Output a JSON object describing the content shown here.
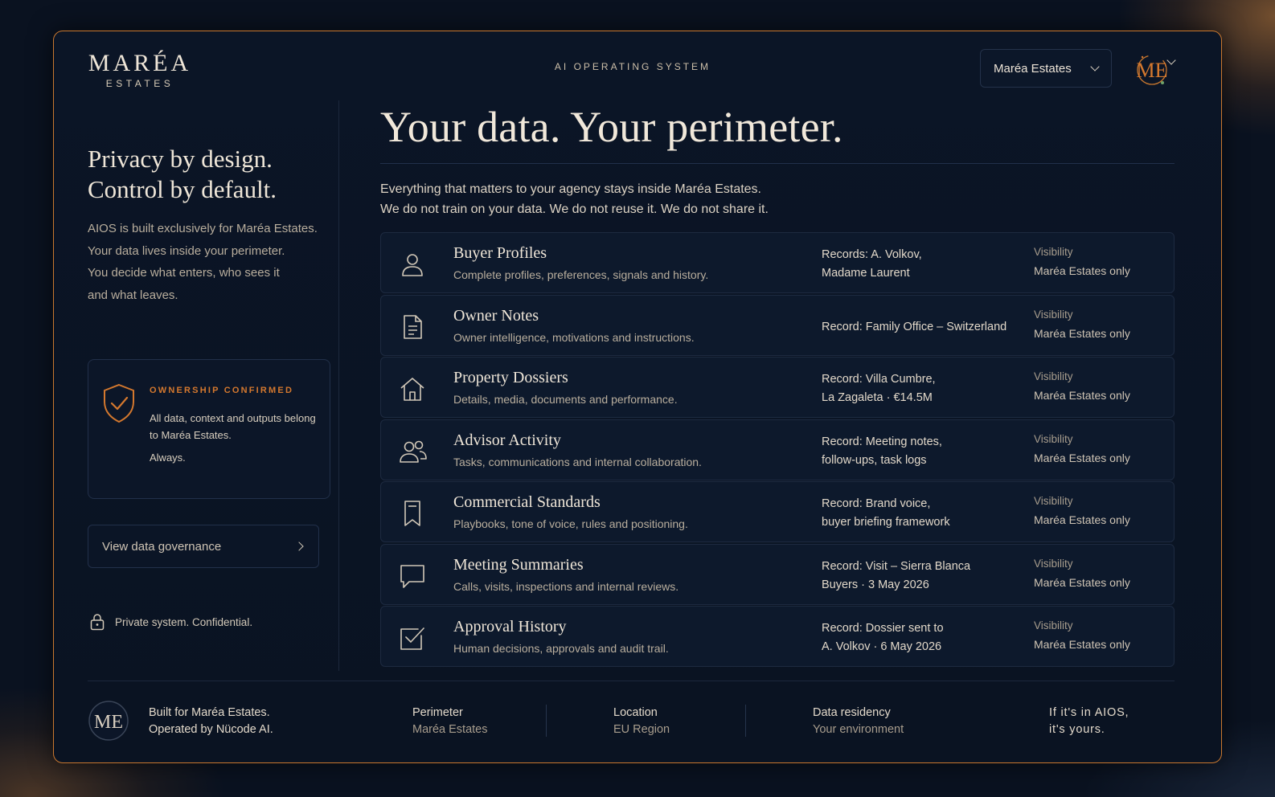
{
  "brand": {
    "name": "MARÉA",
    "sub": "ESTATES"
  },
  "header": {
    "os_label": "AI OPERATING SYSTEM",
    "account": "Maréa Estates",
    "avatar_initials": "ME"
  },
  "left": {
    "title_line1": "Privacy by design.",
    "title_line2": "Control by default.",
    "desc_lines": [
      "AIOS is built exclusively for Maréa Estates.",
      "Your data lives inside your perimeter.",
      "You decide what enters, who sees it",
      "and what leaves."
    ],
    "ownership": {
      "title": "OWNERSHIP CONFIRMED",
      "text": "All data, context and outputs belong to Maréa Estates.",
      "always": "Always."
    },
    "governance_button": "View data governance",
    "private_note": "Private system. Confidential."
  },
  "main": {
    "title": "Your data. Your perimeter.",
    "desc_line1": "Everything that matters to your agency stays inside Maréa Estates.",
    "desc_line2": "We do not train on your data. We do not reuse it. We do not share it.",
    "rows": [
      {
        "icon": "user-icon",
        "name": "Buyer Profiles",
        "desc": "Complete profiles, preferences, signals and history.",
        "record_line1": "Records: A. Volkov,",
        "record_line2": "Madame Laurent",
        "vis_label": "Visibility",
        "vis_value": "Maréa Estates only"
      },
      {
        "icon": "document-icon",
        "name": "Owner Notes",
        "desc": "Owner intelligence, motivations and instructions.",
        "record_line1": "Record: Family Office – Switzerland",
        "record_line2": "",
        "vis_label": "Visibility",
        "vis_value": "Maréa Estates only"
      },
      {
        "icon": "house-icon",
        "name": "Property Dossiers",
        "desc": "Details, media, documents and performance.",
        "record_line1": "Record: Villa Cumbre,",
        "record_line2": "La Zagaleta · €14.5M",
        "vis_label": "Visibility",
        "vis_value": "Maréa Estates only"
      },
      {
        "icon": "users-icon",
        "name": "Advisor Activity",
        "desc": "Tasks, communications and internal collaboration.",
        "record_line1": "Record: Meeting notes,",
        "record_line2": "follow-ups, task logs",
        "vis_label": "Visibility",
        "vis_value": "Maréa Estates only"
      },
      {
        "icon": "bookmark-icon",
        "name": "Commercial Standards",
        "desc": "Playbooks, tone of voice, rules and positioning.",
        "record_line1": "Record: Brand voice,",
        "record_line2": "buyer briefing framework",
        "vis_label": "Visibility",
        "vis_value": "Maréa Estates only"
      },
      {
        "icon": "chat-icon",
        "name": "Meeting Summaries",
        "desc": "Calls, visits, inspections and internal reviews.",
        "record_line1": "Record: Visit – Sierra Blanca",
        "record_line2": "Buyers · 3 May 2026",
        "vis_label": "Visibility",
        "vis_value": "Maréa Estates only"
      },
      {
        "icon": "checkbox-icon",
        "name": "Approval History",
        "desc": "Human decisions, approvals and audit trail.",
        "record_line1": "Record: Dossier sent to",
        "record_line2": "A. Volkov · 6 May 2026",
        "vis_label": "Visibility",
        "vis_value": "Maréa Estates only"
      }
    ]
  },
  "footer": {
    "logo_initials": "ME",
    "built_line1": "Built for Maréa Estates.",
    "built_line2": "Operated by Nücode AI.",
    "perimeter_label": "Perimeter",
    "perimeter_value": "Maréa Estates",
    "location_label": "Location",
    "location_value": "EU Region",
    "residency_label": "Data residency",
    "residency_value": "Your environment",
    "tag_line1": "If it's in AIOS,",
    "tag_line2": "it's yours."
  },
  "colors": {
    "accent": "#d4782e",
    "frame": "#c9782f",
    "background": "#0a1220"
  }
}
